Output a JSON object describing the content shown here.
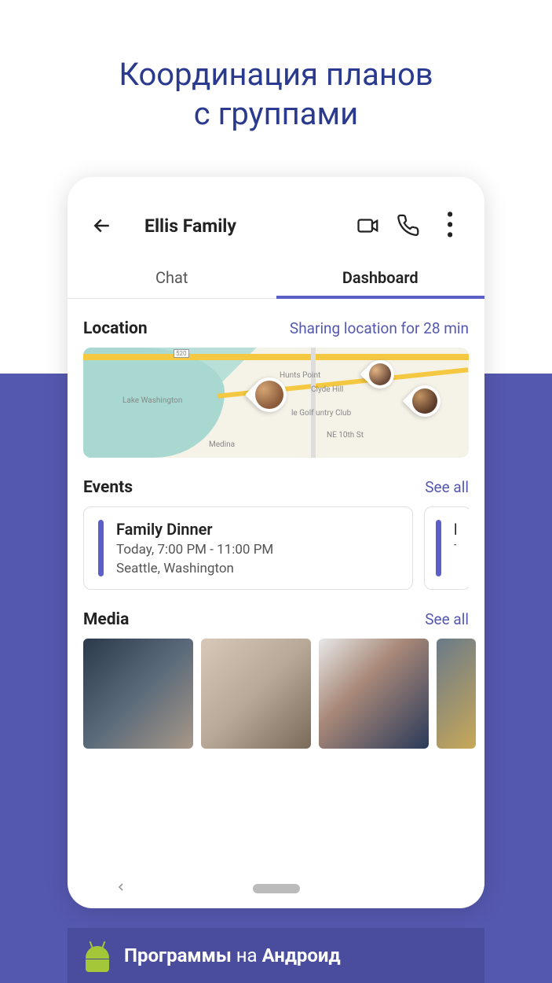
{
  "promo": {
    "title_line1": "Координация планов",
    "title_line2": "с группами"
  },
  "header": {
    "chat_name": "Ellis Family"
  },
  "tabs": {
    "chat": "Chat",
    "dashboard": "Dashboard"
  },
  "location": {
    "title": "Location",
    "status": "Sharing location for 28 min",
    "map_labels": {
      "lake": "Lake Washington",
      "medina": "Medina",
      "hunts": "Hunts Point",
      "clyde": "Clyde Hill",
      "golf": "le Golf untry Club",
      "ne10": "NE 10th St",
      "hwy": "520"
    }
  },
  "events": {
    "title": "Events",
    "see_all": "See all",
    "items": [
      {
        "title": "Family Dinner",
        "time": "Today, 7:00 PM - 11:00 PM",
        "location": "Seattle, Washington"
      },
      {
        "title_peek": "M",
        "time_peek": "To"
      }
    ]
  },
  "media": {
    "title": "Media",
    "see_all": "See all"
  },
  "banner": {
    "text1": "Программы",
    "text2": " на ",
    "text3": "Андроид"
  }
}
